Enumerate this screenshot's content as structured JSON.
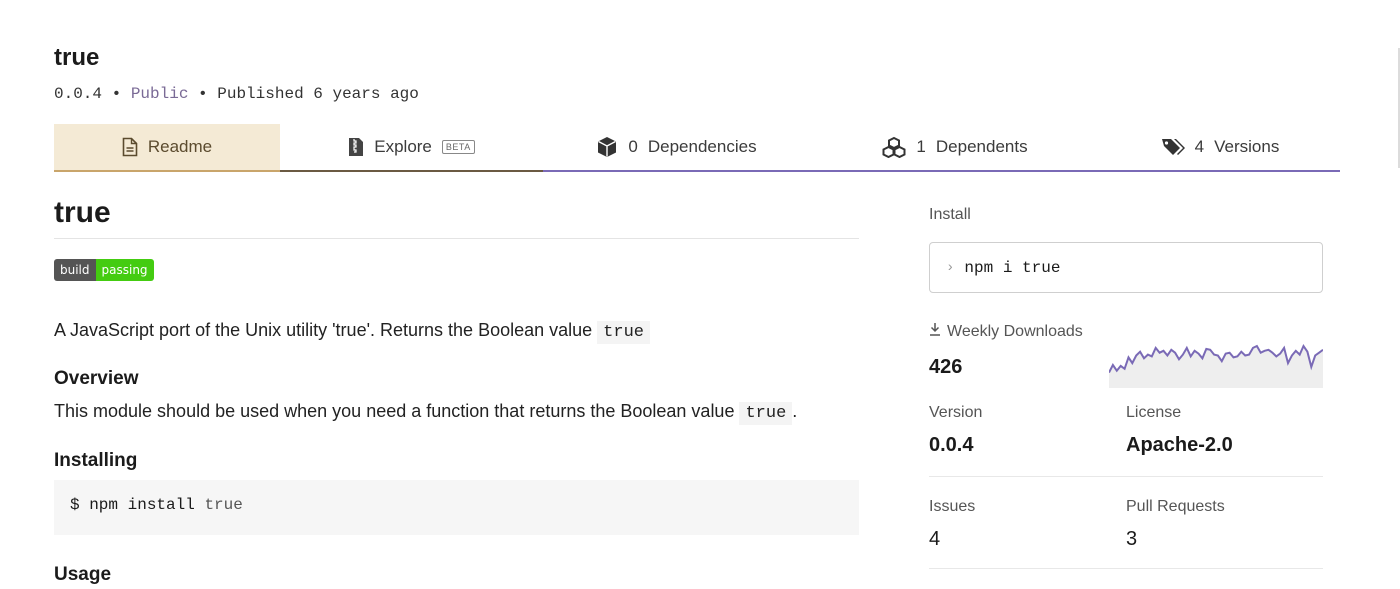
{
  "package": {
    "name": "true",
    "version": "0.0.4",
    "visibility": "Public",
    "published": "Published 6 years ago"
  },
  "tabs": {
    "readme": "Readme",
    "explore": "Explore",
    "explore_badge": "BETA",
    "dependencies_count": "0",
    "dependencies_label": "Dependencies",
    "dependents_count": "1",
    "dependents_label": "Dependents",
    "versions_count": "4",
    "versions_label": "Versions"
  },
  "readme": {
    "title": "true",
    "badge_left": "build",
    "badge_right": "passing",
    "description": "A JavaScript port of the Unix utility 'true'. Returns the Boolean value",
    "description_code": "true",
    "overview_heading": "Overview",
    "overview_text": "This module should be used when you need a function that returns the Boolean value",
    "overview_code": "true",
    "overview_end": ".",
    "installing_heading": "Installing",
    "install_code_cmd": "$ npm install",
    "install_code_arg": "true",
    "usage_heading": "Usage"
  },
  "sidebar": {
    "install_label": "Install",
    "install_command": "npm i true",
    "weekly_downloads_label": "Weekly Downloads",
    "weekly_downloads_value": "426",
    "weekly_downloads_trend": [
      12,
      20,
      14,
      19,
      16,
      28,
      22,
      30,
      34,
      27,
      31,
      29,
      38,
      33,
      35,
      30,
      36,
      33,
      26,
      31,
      38,
      29,
      35,
      32,
      27,
      37,
      36,
      31,
      30,
      24,
      32,
      33,
      28,
      29,
      34,
      30,
      31,
      38,
      40,
      33,
      35,
      36,
      33,
      29,
      32,
      38,
      22,
      30,
      35,
      31,
      40,
      34,
      18,
      30,
      33,
      36
    ],
    "version_label": "Version",
    "version_value": "0.0.4",
    "license_label": "License",
    "license_value": "Apache-2.0",
    "issues_label": "Issues",
    "issues_value": "4",
    "pull_requests_label": "Pull Requests",
    "pull_requests_value": "3"
  },
  "colors": {
    "accent_purple": "#7a6ab6",
    "readme_tab_bg": "#f4ead5",
    "badge_green": "#44cc11"
  }
}
